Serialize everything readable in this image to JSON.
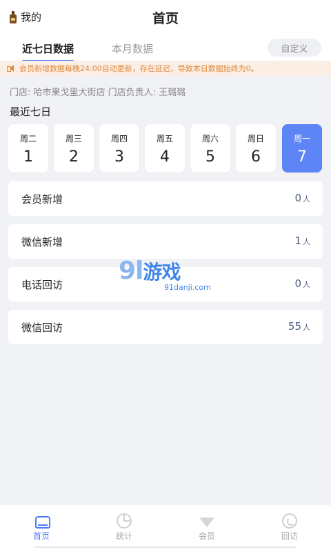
{
  "header": {
    "me_label": "我的",
    "title": "首页"
  },
  "tabs": {
    "active": "近七日数据",
    "inactive": "本月数据",
    "custom_button": "自定义"
  },
  "notice": {
    "text": "会员新增数据每晚24:00自动更新，存在延迟，导致本日数据始终为0。",
    "color": "#e08a3c"
  },
  "store_info": "门店: 哈市果戈里大街店   门店负责人: 王璐璐",
  "recent_label": "最近七日",
  "days": [
    {
      "weekday": "周二",
      "date": "1"
    },
    {
      "weekday": "周三",
      "date": "2"
    },
    {
      "weekday": "周四",
      "date": "3"
    },
    {
      "weekday": "周五",
      "date": "4"
    },
    {
      "weekday": "周六",
      "date": "5"
    },
    {
      "weekday": "周日",
      "date": "6"
    },
    {
      "weekday": "周一",
      "date": "7",
      "selected": true
    }
  ],
  "stats": [
    {
      "label": "会员新增",
      "value": "0",
      "unit": "人"
    },
    {
      "label": "微信新增",
      "value": "1",
      "unit": "人"
    },
    {
      "label": "电话回访",
      "value": "0",
      "unit": "人"
    },
    {
      "label": "微信回访",
      "value": "55",
      "unit": "人"
    }
  ],
  "watermark": {
    "main": "9l",
    "game": "游戏",
    "domain": "91danji.com"
  },
  "bottom_nav": [
    {
      "label": "首页",
      "icon": "home-icon",
      "active": true
    },
    {
      "label": "统计",
      "icon": "pie-chart-icon"
    },
    {
      "label": "会员",
      "icon": "gem-icon"
    },
    {
      "label": "回访",
      "icon": "phone-call-icon"
    }
  ],
  "colors": {
    "accent": "#4b7cf6",
    "selected_day": "#5d85f6",
    "value_text": "#4c5e80",
    "background": "#f1f2f6"
  }
}
